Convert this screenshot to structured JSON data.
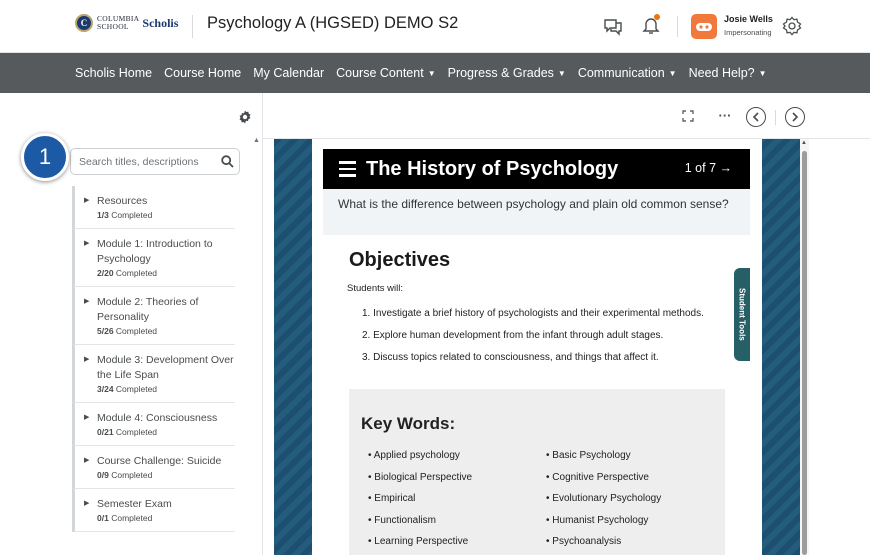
{
  "header": {
    "logo_seal_letter": "C",
    "school_line1": "COLUMBIA",
    "school_line2": "SCHOOL",
    "scholis_word": "Scholis",
    "course_title": "Psychology A (HGSED) DEMO S2",
    "user_name": "Josie Wells",
    "user_status": "Impersonating",
    "icons": [
      "chat-icon",
      "bell-icon",
      "user-avatar-icon",
      "gear-icon"
    ],
    "notification_dot_color": "#e87511",
    "avatar_color": "#f1793b"
  },
  "nav": {
    "items": [
      {
        "label": "Scholis Home",
        "dropdown": false
      },
      {
        "label": "Course Home",
        "dropdown": false
      },
      {
        "label": "My Calendar",
        "dropdown": false
      },
      {
        "label": "Course Content",
        "dropdown": true
      },
      {
        "label": "Progress & Grades",
        "dropdown": true
      },
      {
        "label": "Communication",
        "dropdown": true
      },
      {
        "label": "Need Help?",
        "dropdown": true
      }
    ],
    "caret": "⌄",
    "background": "#565a5c"
  },
  "sidebar": {
    "search_placeholder": "Search titles, descriptions",
    "callout_number": "1",
    "callout_color": "#1d5aa6",
    "modules": [
      {
        "title": "Resources",
        "progress": "1/3",
        "suffix": "Completed"
      },
      {
        "title": "Module 1: Introduction to Psychology",
        "progress": "2/20",
        "suffix": "Completed"
      },
      {
        "title": "Module 2: Theories of Personality",
        "progress": "5/26",
        "suffix": "Completed"
      },
      {
        "title": "Module 3: Development Over the Life Span",
        "progress": "3/24",
        "suffix": "Completed"
      },
      {
        "title": "Module 4: Consciousness",
        "progress": "0/21",
        "suffix": "Completed"
      },
      {
        "title": "Course Challenge: Suicide",
        "progress": "0/9",
        "suffix": "Completed"
      },
      {
        "title": "Semester Exam",
        "progress": "0/1",
        "suffix": "Completed"
      }
    ]
  },
  "toolbar": {
    "icons": [
      "fullscreen-icon",
      "more-options-icon",
      "previous-icon",
      "next-icon"
    ],
    "more_label": "···"
  },
  "document": {
    "title": "The History of Psychology",
    "page_count": "1 of 7 →",
    "question": "What is the difference between psychology and plain old common sense?",
    "objectives_heading": "Objectives",
    "students_will": "Students will:",
    "objectives": [
      "1. Investigate a brief history of psychologists and their experimental methods.",
      "2. Explore human development from the infant through adult stages.",
      "3. Discuss topics related to consciousness, and things that affect it."
    ],
    "key_words_heading": "Key Words:",
    "key_words_left": [
      "• Applied psychology",
      "• Biological Perspective",
      "• Empirical",
      "• Functionalism",
      "• Learning Perspective"
    ],
    "key_words_right": [
      "• Basic Psychology",
      "• Cognitive Perspective",
      "• Evolutionary Psychology",
      "• Humanist Psychology",
      "• Psychoanalysis"
    ],
    "title_bar_color": "#000000",
    "question_bg": "#f1f4f6",
    "key_words_bg": "#eeeeee"
  },
  "student_tools": {
    "label": "Student Tools",
    "color": "#275f67"
  }
}
